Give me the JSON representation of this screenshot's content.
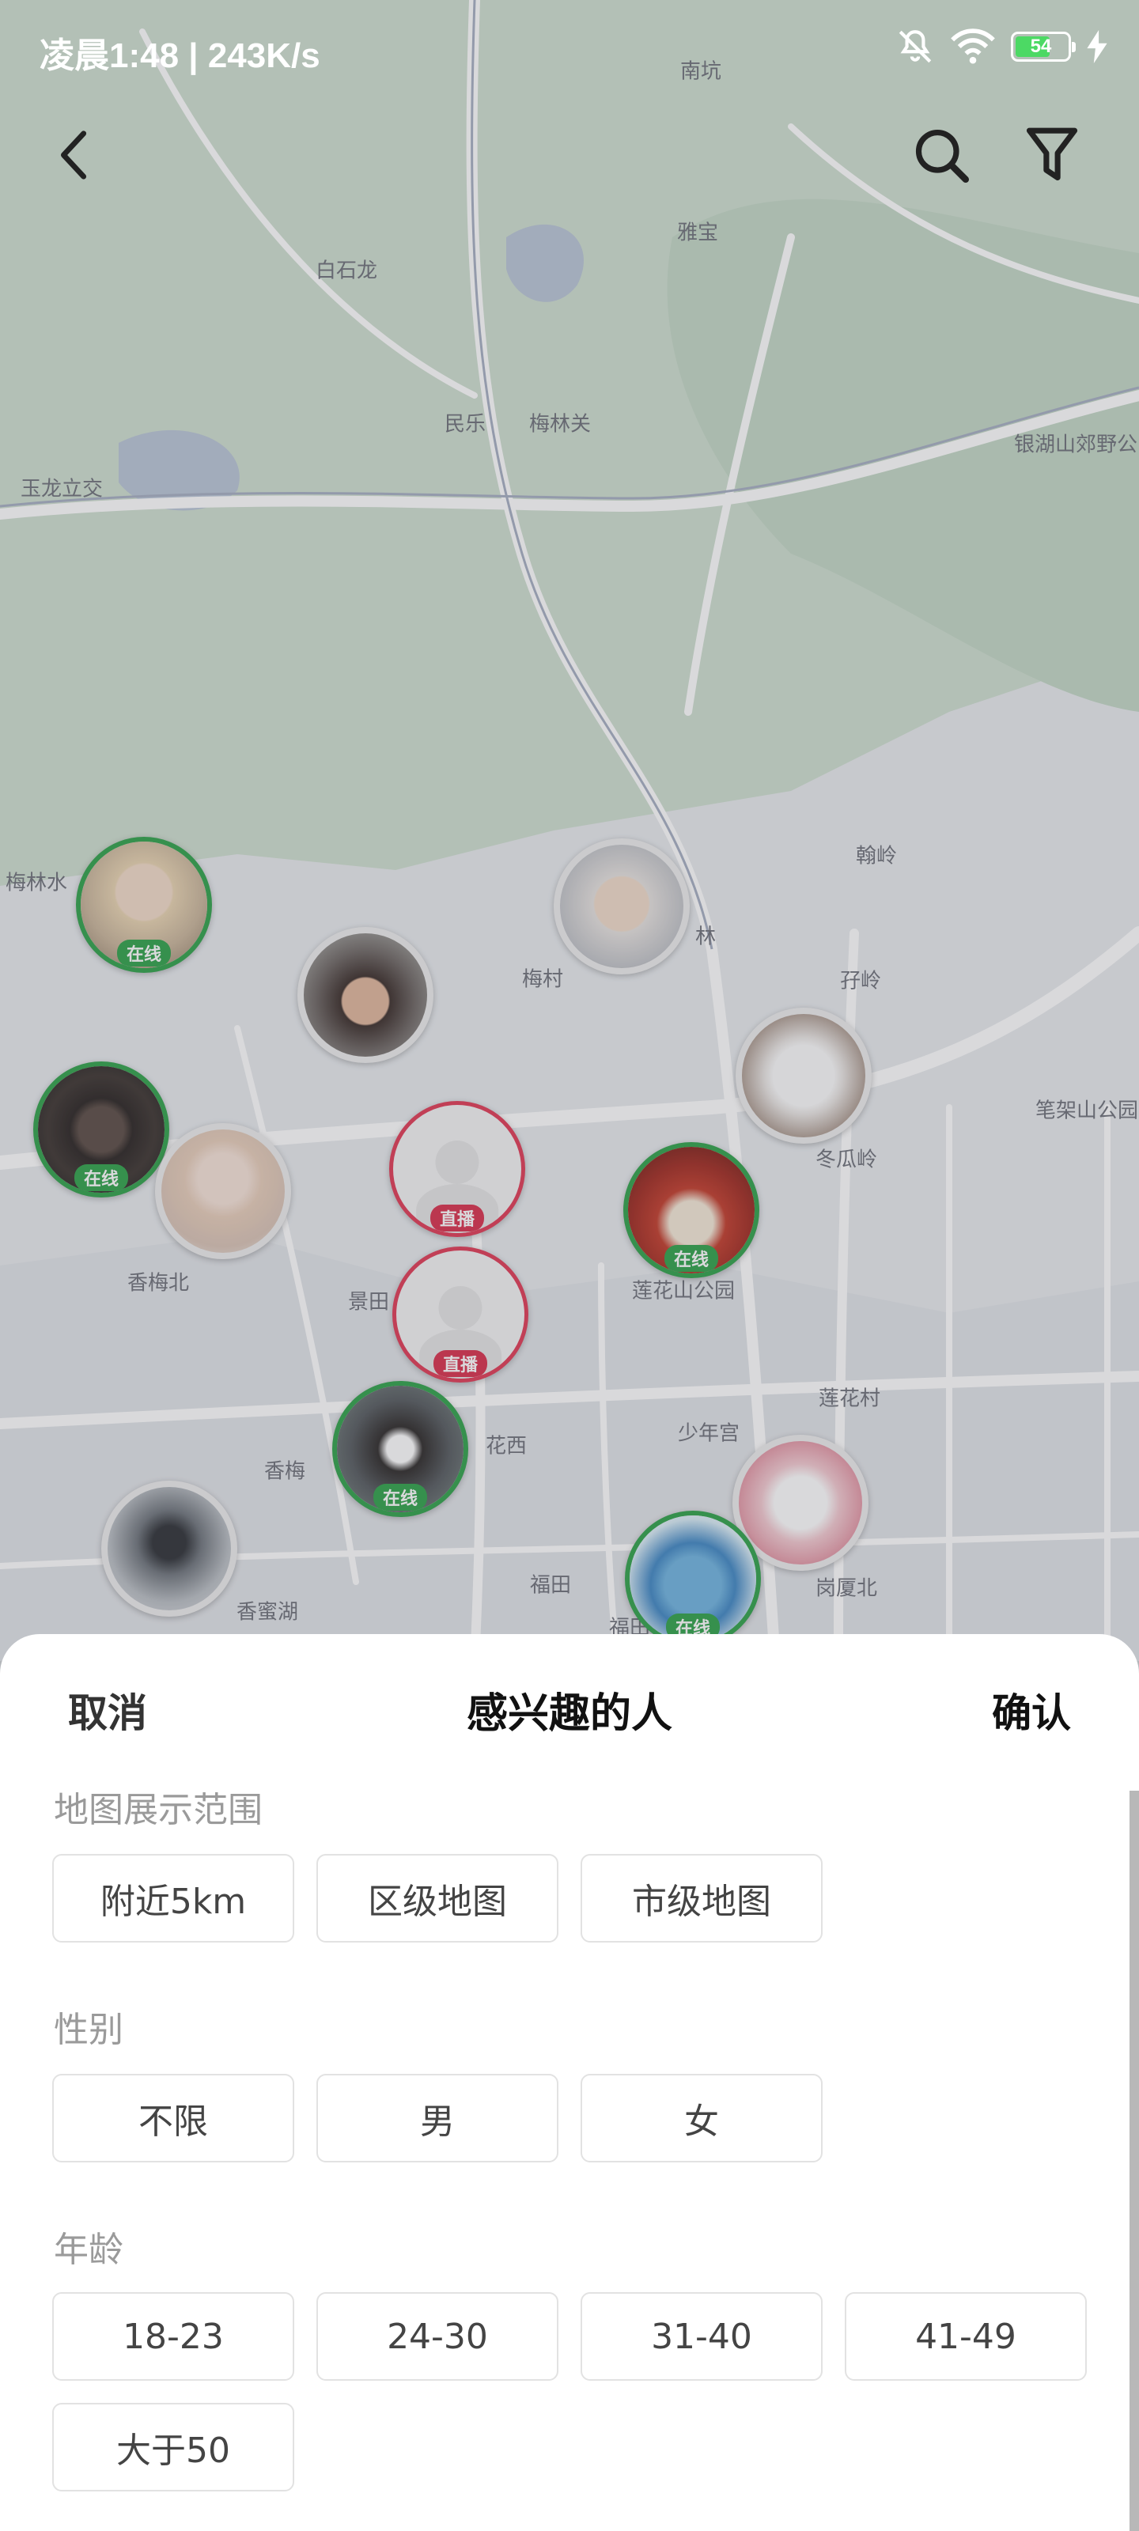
{
  "status_bar": {
    "time": "凌晨1:48 | 243K/s",
    "battery": "54",
    "icons": [
      "mute-bell-icon",
      "wifi-icon",
      "battery-icon",
      "charging-icon"
    ]
  },
  "nav": {
    "icons": [
      "back-arrow-icon",
      "search-icon",
      "filter-icon"
    ]
  },
  "map": {
    "labels": [
      "南坑",
      "雅宝",
      "白石龙",
      "民乐",
      "梅林关",
      "银湖山郊野公",
      "玉龙立交",
      "梅林水",
      "翰岭",
      "梅村",
      "林",
      "孖岭",
      "笔架山公园",
      "冬瓜岭",
      "香梅北",
      "景田",
      "莲花山公园",
      "莲花村",
      "香梅",
      "花西",
      "少年宫",
      "福田",
      "福田",
      "岗厦北",
      "香蜜湖"
    ],
    "markers": [
      {
        "status": "在线"
      },
      {
        "status": ""
      },
      {
        "status": ""
      },
      {
        "status": ""
      },
      {
        "status": "在线"
      },
      {
        "status": ""
      },
      {
        "status": "直播"
      },
      {
        "status": "在线"
      },
      {
        "status": "直播"
      },
      {
        "status": "在线"
      },
      {
        "status": ""
      },
      {
        "status": ""
      },
      {
        "status": "在线"
      }
    ]
  },
  "sheet": {
    "cancel": "取消",
    "title": "感兴趣的人",
    "confirm": "确认",
    "sections": [
      {
        "label": "地图展示范围",
        "options": [
          "附近5km",
          "区级地图",
          "市级地图"
        ]
      },
      {
        "label": "性别",
        "options": [
          "不限",
          "男",
          "女"
        ]
      },
      {
        "label": "年龄",
        "options": [
          "18-23",
          "24-30",
          "31-40",
          "41-49",
          "大于50"
        ]
      }
    ]
  },
  "colors": {
    "online": "#2fa24a",
    "live": "#d9304c",
    "map_road": "#ffffff",
    "map_green": "#c8d6c8"
  }
}
